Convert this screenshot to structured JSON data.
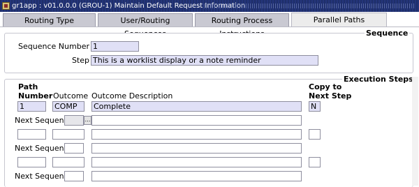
{
  "window": {
    "title": "gr1app : v01.0.0.0 (GROU-1) Maintain Default Request Information"
  },
  "tabs": [
    {
      "label": "Routing Type"
    },
    {
      "label": "User/Routing Sequences"
    },
    {
      "label": "Routing Process Instructions"
    },
    {
      "label": "Parallel Paths"
    }
  ],
  "sequence": {
    "title": "Sequence",
    "number_label": "Sequence Number",
    "number_value": "1",
    "step_label": "Step",
    "step_value": "This is a worklist display or a note reminder"
  },
  "execution": {
    "title": "Execution Steps",
    "headers": {
      "path_line1": "Path",
      "path_line2": "Number",
      "outcome": "Outcome",
      "outcome_description": "Outcome Description",
      "copy_line1": "Copy to",
      "copy_line2": "Next Step"
    },
    "rows": [
      {
        "path": "1",
        "outcome": "COMP",
        "description": "Complete",
        "copy": "N",
        "next_sequence": ""
      },
      {
        "path": "",
        "outcome": "",
        "description": "",
        "copy": "",
        "next_sequence": ""
      },
      {
        "path": "",
        "outcome": "",
        "description": "",
        "copy": "",
        "next_sequence": ""
      }
    ],
    "next_sequence_label": "Next Sequence",
    "lov_glyph": "…"
  }
}
